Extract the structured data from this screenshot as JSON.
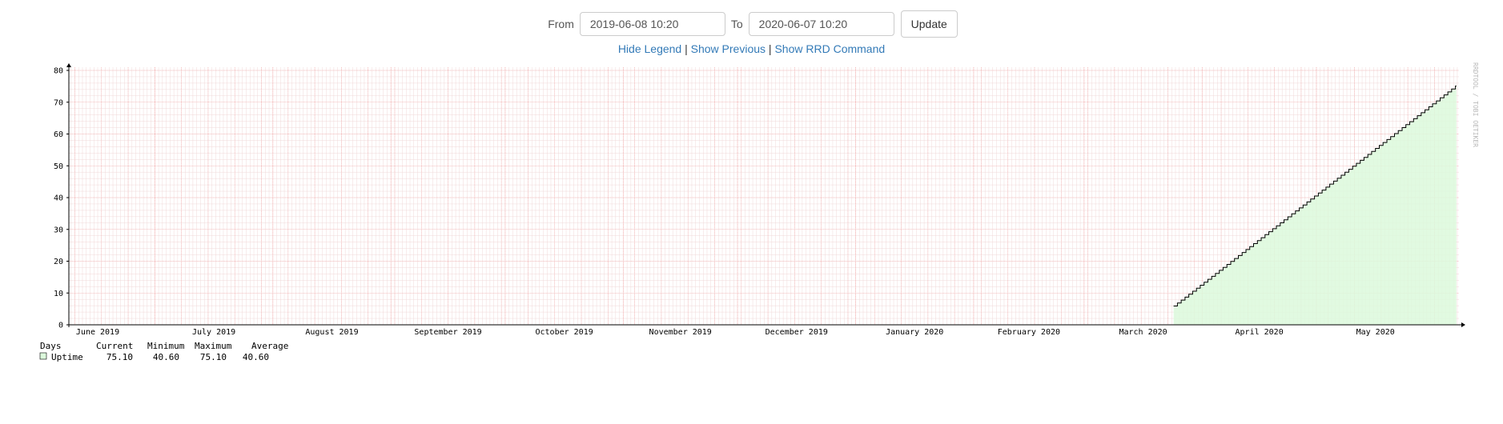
{
  "controls": {
    "from_label": "From",
    "from_value": "2019-06-08 10:20",
    "to_label": "To",
    "to_value": "2020-06-07 10:20",
    "update_label": "Update"
  },
  "links": {
    "hide_legend": "Hide Legend",
    "separator": "|",
    "show_previous": "Show Previous",
    "show_rrd_command": "Show RRD Command"
  },
  "watermark": "RRDTOOL / TOBI OETIKER",
  "colors": {
    "grid_minor": "#f0d8d8",
    "grid_major": "#f5a8a8",
    "area_fill": "#dcf9dc",
    "line": "#000000"
  },
  "chart_data": {
    "type": "area",
    "title": "",
    "xlabel": "",
    "ylabel": "",
    "ylim": [
      0,
      80
    ],
    "yticks": [
      0,
      10,
      20,
      30,
      40,
      50,
      60,
      70,
      80
    ],
    "xlim": [
      "2019-06-08 10:20",
      "2020-06-07 10:20"
    ],
    "xtick_labels": [
      {
        "date": "2019-06-01",
        "label": "June 2019"
      },
      {
        "date": "2019-07-01",
        "label": "July 2019"
      },
      {
        "date": "2019-08-01",
        "label": "August 2019"
      },
      {
        "date": "2019-09-01",
        "label": "September 2019"
      },
      {
        "date": "2019-10-01",
        "label": "October 2019"
      },
      {
        "date": "2019-11-01",
        "label": "November 2019"
      },
      {
        "date": "2019-12-01",
        "label": "December 2019"
      },
      {
        "date": "2020-01-01",
        "label": "January 2020"
      },
      {
        "date": "2020-02-01",
        "label": "February 2020"
      },
      {
        "date": "2020-03-01",
        "label": "March 2020"
      },
      {
        "date": "2020-04-01",
        "label": "April 2020"
      },
      {
        "date": "2020-05-01",
        "label": "May 2020"
      }
    ],
    "grid": true,
    "series": [
      {
        "name": "Uptime",
        "color": "#dcf9dc",
        "x": [
          "2020-03-24",
          "2020-06-06"
        ],
        "y": [
          5.9,
          75.1
        ],
        "step": "daily"
      }
    ],
    "legend": {
      "placement": "bottom-left",
      "unit": "Days",
      "headers": [
        "Current",
        "Minimum",
        "Maximum",
        "Average"
      ],
      "rows": [
        {
          "name": "Uptime",
          "current": "75.10",
          "minimum": "40.60",
          "maximum": "75.10",
          "average": "40.60"
        }
      ]
    }
  }
}
